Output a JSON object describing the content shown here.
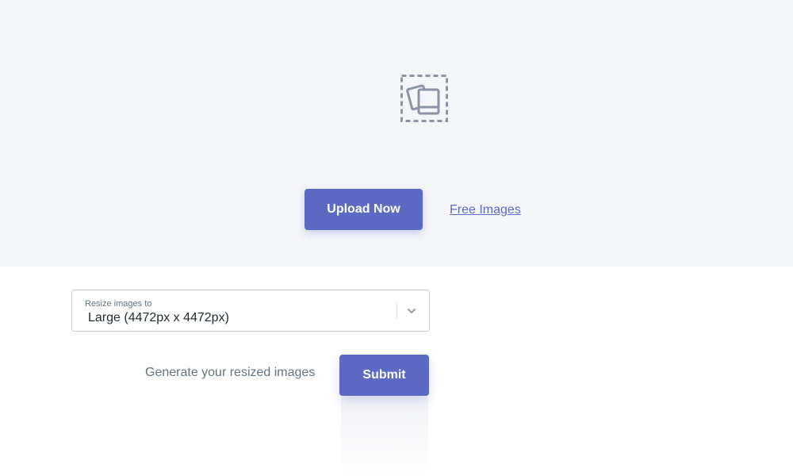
{
  "upload_area": {
    "placeholder_icon": "images-icon",
    "upload_label": "Upload Now",
    "free_images_label": "Free Images"
  },
  "resize": {
    "label": "Resize images to",
    "selected_value": "Large (4472px x 4472px)",
    "dropdown_icon": "chevron-down-icon"
  },
  "generate": {
    "text": "Generate your resized images",
    "submit_label": "Submit"
  },
  "colors": {
    "accent": "#5c6ac4",
    "upload_area_background": "#f5f6f9",
    "muted_text": "#637381"
  }
}
